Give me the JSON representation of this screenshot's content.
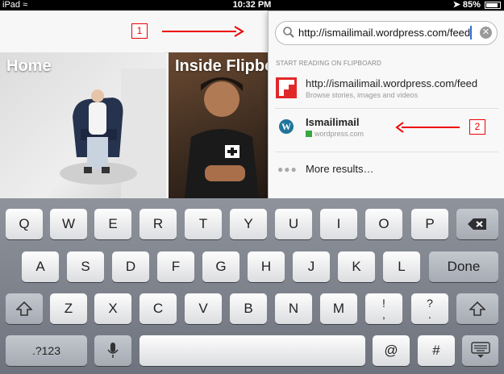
{
  "status_bar": {
    "device": "iPad",
    "time": "10:32 PM",
    "battery": "85%"
  },
  "tiles": [
    {
      "label": "Home"
    },
    {
      "label": "Inside Flipbo"
    }
  ],
  "annotations": {
    "callout_1": "1",
    "callout_2": "2",
    "arrow_color": "#e00000"
  },
  "search": {
    "value": "http://ismailimail.wordpress.com/feed",
    "section_title": "START READING ON FLIPBOARD",
    "results": [
      {
        "title": "http://ismailimail.wordpress.com/feed",
        "subtitle": "Browse stories, images and videos",
        "icon": "flipboard-icon"
      },
      {
        "title": "Ismailimail",
        "subtitle": "wordpress.com",
        "icon": "wordpress-icon"
      }
    ],
    "more_label": "More results…"
  },
  "keyboard": {
    "row1": [
      "Q",
      "W",
      "E",
      "R",
      "T",
      "Y",
      "U",
      "I",
      "O",
      "P"
    ],
    "row2": [
      "A",
      "S",
      "D",
      "F",
      "G",
      "H",
      "J",
      "K",
      "L"
    ],
    "row3": [
      "Z",
      "X",
      "C",
      "V",
      "B",
      "N",
      "M"
    ],
    "row3_punct": [
      [
        "!",
        ","
      ],
      [
        "?",
        "."
      ]
    ],
    "done": "Done",
    "numbers": ".?123",
    "at": "@",
    "hash": "#"
  },
  "colors": {
    "flipboard_red": "#e12828",
    "wordpress_blue": "#21759b",
    "caret_blue": "#2a6fd8"
  }
}
